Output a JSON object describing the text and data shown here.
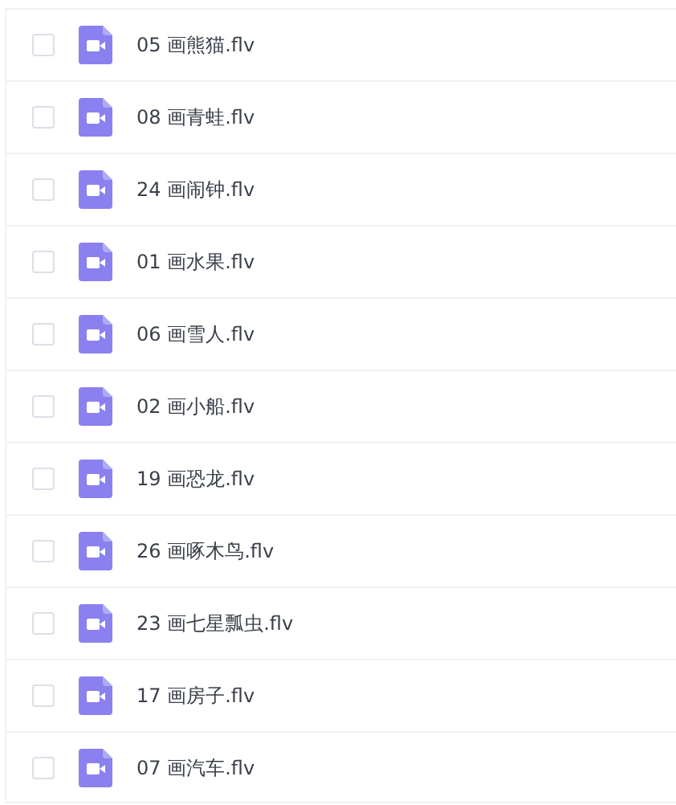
{
  "files": [
    {
      "name": "05 画熊猫.flv",
      "checked": false
    },
    {
      "name": "08 画青蛙.flv",
      "checked": false
    },
    {
      "name": "24 画闹钟.flv",
      "checked": false
    },
    {
      "name": "01 画水果.flv",
      "checked": false
    },
    {
      "name": "06 画雪人.flv",
      "checked": false
    },
    {
      "name": "02 画小船.flv",
      "checked": false
    },
    {
      "name": "19 画恐龙.flv",
      "checked": false
    },
    {
      "name": "26 画啄木鸟.flv",
      "checked": false
    },
    {
      "name": "23 画七星瓢虫.flv",
      "checked": false
    },
    {
      "name": "17 画房子.flv",
      "checked": false
    },
    {
      "name": "07 画汽车.flv",
      "checked": false
    }
  ]
}
